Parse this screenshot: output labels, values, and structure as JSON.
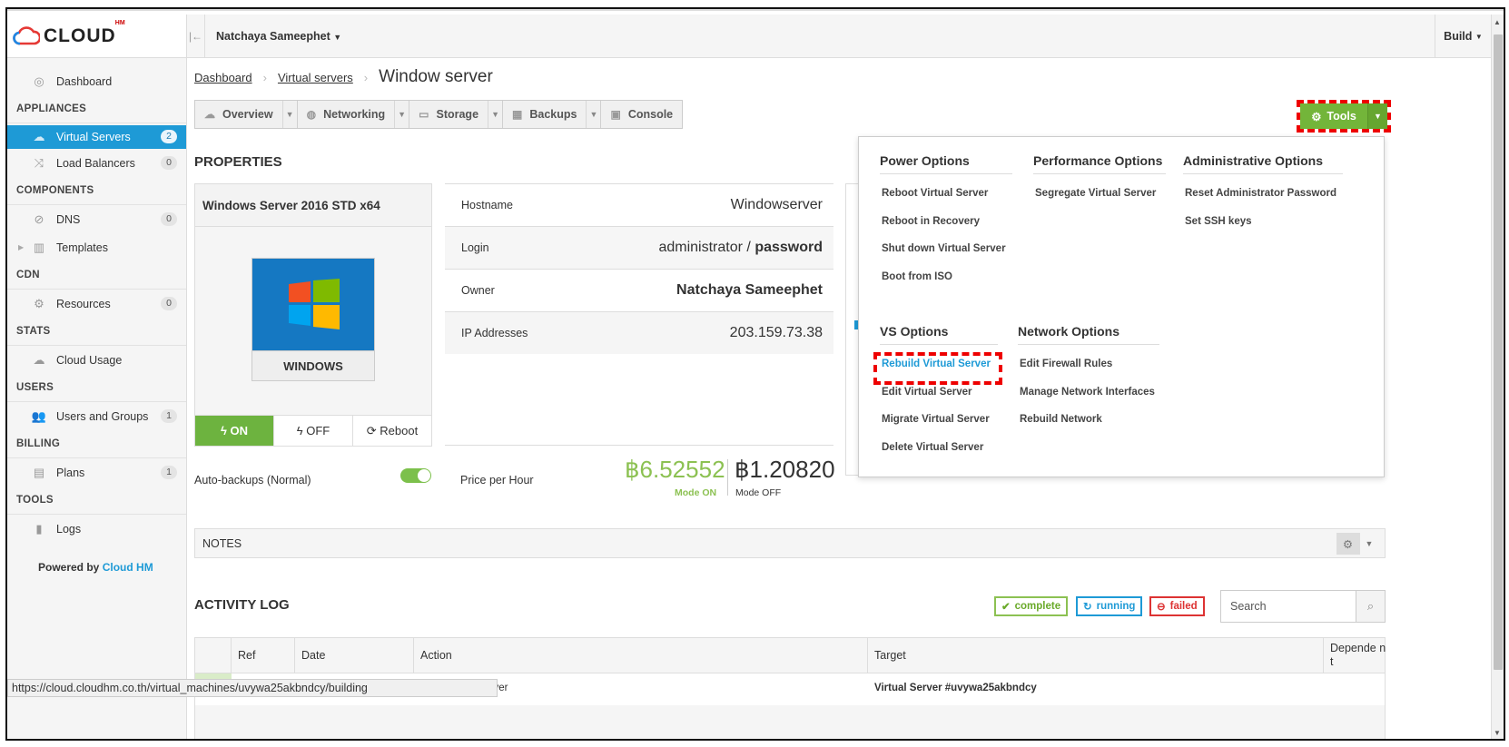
{
  "app": {
    "brand": "CLOUD",
    "brand_sup": "HM"
  },
  "topbar": {
    "user": "Natchaya Sameephet",
    "build": "Build"
  },
  "sidebar": {
    "dashboard": "Dashboard",
    "sec_appliances": "APPLIANCES",
    "virtual_servers": {
      "label": "Virtual Servers",
      "count": "2"
    },
    "load_balancers": {
      "label": "Load Balancers",
      "count": "0"
    },
    "sec_components": "COMPONENTS",
    "dns": {
      "label": "DNS",
      "count": "0"
    },
    "templates": "Templates",
    "sec_cdn": "CDN",
    "resources": {
      "label": "Resources",
      "count": "0"
    },
    "sec_stats": "STATS",
    "cloud_usage": "Cloud Usage",
    "sec_users": "USERS",
    "users_groups": {
      "label": "Users and Groups",
      "count": "1"
    },
    "sec_billing": "BILLING",
    "plans": {
      "label": "Plans",
      "count": "1"
    },
    "sec_tools": "TOOLS",
    "logs": "Logs",
    "powered_prefix": "Powered by",
    "powered_brand": "Cloud HM"
  },
  "breadcrumb": {
    "dashboard": "Dashboard",
    "virtual_servers": "Virtual servers",
    "current": "Window server"
  },
  "tabs": [
    "Overview",
    "Networking",
    "Storage",
    "Backups",
    "Console"
  ],
  "tools_label": "Tools",
  "properties": {
    "title": "PROPERTIES",
    "os_name": "Windows Server 2016 STD x64",
    "os_tile": "WINDOWS",
    "power": {
      "on": "ON",
      "off": "OFF",
      "reboot": "Reboot"
    },
    "hostname_k": "Hostname",
    "hostname_v": "Windowserver",
    "login_k": "Login",
    "login_user": "administrator",
    "login_sep": "/",
    "login_pass": "password",
    "owner_k": "Owner",
    "owner_v": "Natchaya Sameephet",
    "ip_k": "IP Addresses",
    "ip_v": "203.159.73.38",
    "autobackups": "Auto-backups (Normal)",
    "price_label": "Price per Hour",
    "price_on": "฿6.52552",
    "mode_on": "Mode ON",
    "price_off": "฿1.20820",
    "mode_off": "Mode OFF"
  },
  "menu": {
    "power": {
      "title": "Power Options",
      "items": [
        "Reboot Virtual Server",
        "Reboot in Recovery",
        "Shut down Virtual Server",
        "Boot from ISO"
      ]
    },
    "performance": {
      "title": "Performance Options",
      "items": [
        "Segregate Virtual Server"
      ]
    },
    "admin": {
      "title": "Administrative Options",
      "items": [
        "Reset Administrator Password",
        "Set SSH keys"
      ]
    },
    "vs": {
      "title": "VS Options",
      "items": [
        "Rebuild Virtual Server",
        "Edit Virtual Server",
        "Migrate Virtual Server",
        "Delete Virtual Server"
      ]
    },
    "network": {
      "title": "Network Options",
      "items": [
        "Edit Firewall Rules",
        "Manage Network Interfaces",
        "Rebuild Network"
      ]
    }
  },
  "notes": {
    "title": "NOTES"
  },
  "activity": {
    "title": "ACTIVITY LOG",
    "filters": [
      "complete",
      "running",
      "failed"
    ],
    "search_placeholder": "Search",
    "columns": [
      "Ref",
      "Date",
      "Action",
      "Target",
      "Depende nt"
    ],
    "row": {
      "action_fragment": "lServer",
      "target": "Virtual Server #uvywa25akbndcy"
    }
  },
  "statusbar": "https://cloud.cloudhm.co.th/virtual_machines/uvywa25akbndcy/building"
}
